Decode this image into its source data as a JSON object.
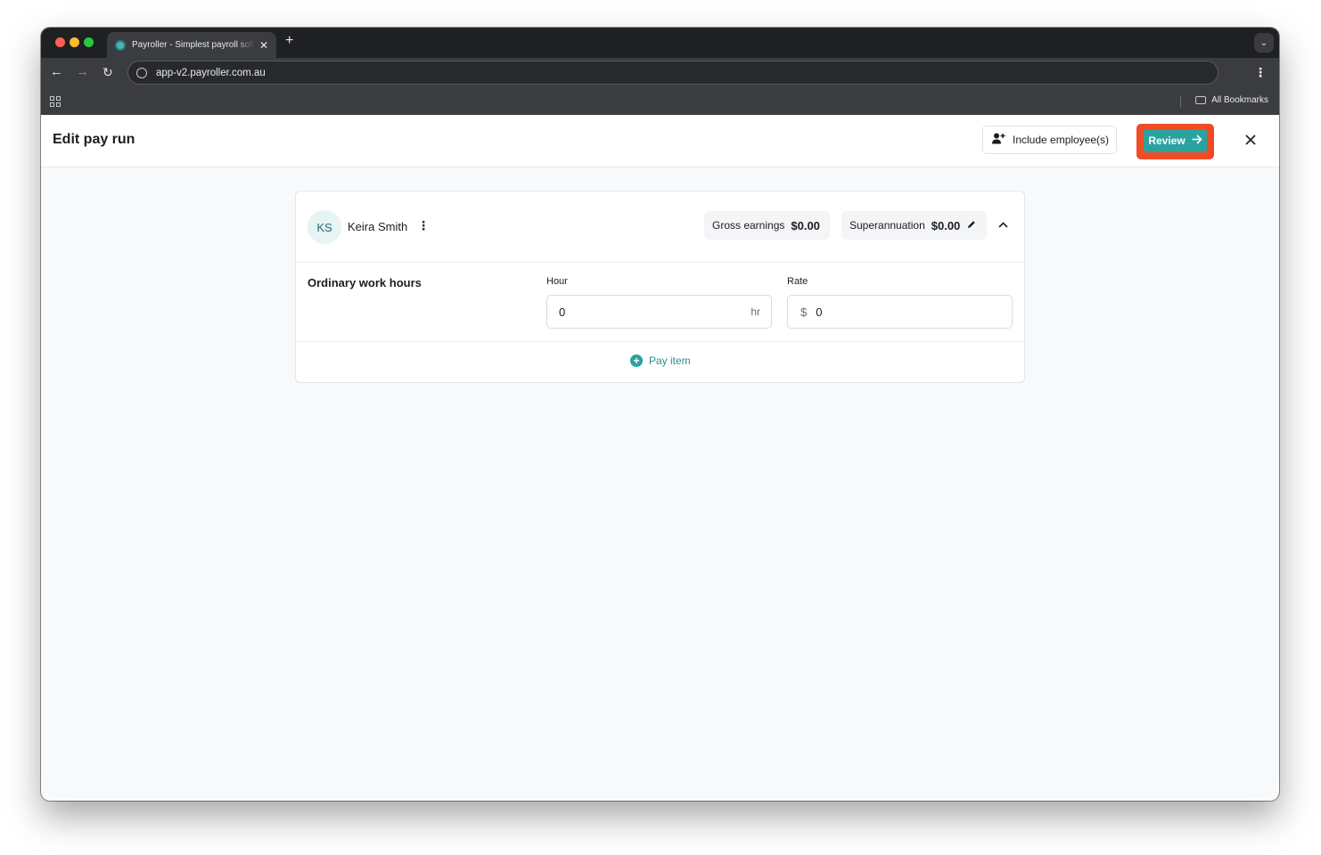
{
  "browser": {
    "tab_title": "Payroller - Simplest payroll software",
    "url": "app-v2.payroller.com.au",
    "bookmarks_label": "All Bookmarks"
  },
  "header": {
    "title": "Edit pay run",
    "include_label": "Include employee(s)",
    "review_label": "Review"
  },
  "employee": {
    "initials": "KS",
    "name": "Keira Smith",
    "gross_label": "Gross earnings",
    "gross_value": "$0.00",
    "super_label": "Superannuation",
    "super_value": "$0.00"
  },
  "ordinary": {
    "label": "Ordinary work hours",
    "hour_label": "Hour",
    "hour_value": "0",
    "hour_suffix": "hr",
    "rate_label": "Rate",
    "rate_prefix": "$",
    "rate_value": "0"
  },
  "pay_item_label": "Pay item",
  "colors": {
    "accent": "#2aa39f",
    "highlight": "#ef4b25"
  }
}
